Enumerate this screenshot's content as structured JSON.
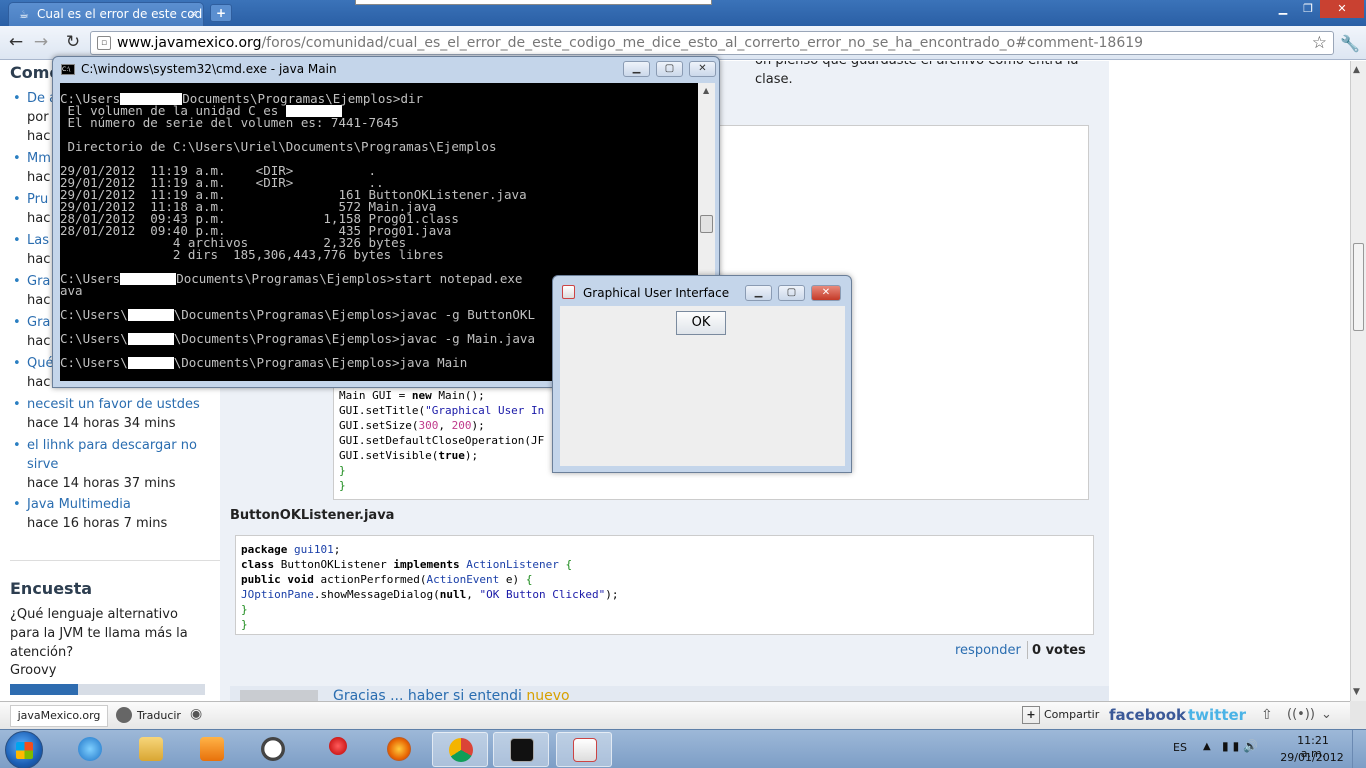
{
  "browser": {
    "tab_title": "Cual es el error de este codi",
    "tab_close": "×",
    "new_tab": "+",
    "url_host": "www.javamexico.org",
    "url_path": "/foros/comunidad/cual_es_el_error_de_este_codigo_me_dice_esto_al_correrto_error_no_se_ha_encontrado_o#comment-18619"
  },
  "sidebar": {
    "title": "Come",
    "items": [
      {
        "link": "De a",
        "meta": [
          "por",
          "hac"
        ]
      },
      {
        "link": "Mmm",
        "meta": [
          "hac"
        ]
      },
      {
        "link": "Pru",
        "meta": [
          "hac"
        ]
      },
      {
        "link": "Las",
        "meta": [
          "hac"
        ]
      },
      {
        "link": "Gra",
        "meta": [
          "hac"
        ]
      },
      {
        "link": "Gra",
        "meta": [
          "hac"
        ]
      },
      {
        "link": "Qué",
        "meta": [
          "hac"
        ]
      },
      {
        "link": "necesit un favor de ustdes",
        "meta": [
          "hace 14 horas 34 mins"
        ]
      },
      {
        "link": "el lihnk para descargar no sirve",
        "meta": [
          "hace 14 horas 37 mins"
        ]
      },
      {
        "link": "Java Multimedia",
        "meta": [
          "hace 16 horas 7 mins"
        ]
      }
    ],
    "poll_title": "Encuesta",
    "poll_question": "¿Qué lenguaje alternativo para la JVM te llama más la atención?",
    "poll_option": "Groovy",
    "poll_fraction": 0.35
  },
  "content": {
    "top_text": "on pienso que guardaste el archivo como entra la clase.",
    "file_label": "ButtonOKListener.java",
    "reply_label": "responder",
    "votes": "0 votes",
    "next_title": "Gracias ... haber si entendi",
    "next_badge": "nuevo"
  },
  "sitebar": {
    "home": "javaMexico.org",
    "translate": "Traducir",
    "share": "Compartir",
    "facebook": "facebook",
    "twitter": "twitter"
  },
  "cmd": {
    "title": "C:\\windows\\system32\\cmd.exe - java  Main"
  },
  "gui": {
    "title": "Graphical User Interface",
    "ok_label": "OK"
  },
  "taskbar": {
    "lang": "ES",
    "time": "11:21 a.m.",
    "date": "29/01/2012"
  },
  "icons": {
    "back": "back-arrow-icon",
    "forward": "forward-arrow-icon",
    "reload": "reload-icon",
    "star": "bookmark-star-icon",
    "wrench": "wrench-icon"
  }
}
